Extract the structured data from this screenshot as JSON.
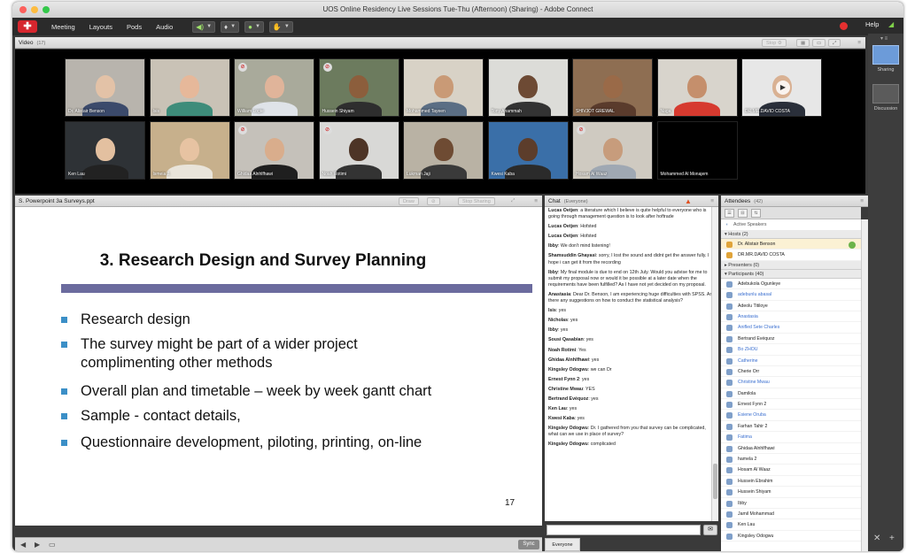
{
  "window": {
    "title": "UOS Online Residency Live Sessions Tue-Thu (Afternoon) (Sharing) - Adobe Connect"
  },
  "menubar": {
    "items": [
      "Meeting",
      "Layouts",
      "Pods",
      "Audio"
    ],
    "help": "Help"
  },
  "video_pod": {
    "title": "Video",
    "count": "(17)",
    "stop_label": "Stop",
    "participants": [
      {
        "name": "Dr. Alistair Benson",
        "bg": "#b8b4ad",
        "skin": "#e3c2a7",
        "shirt": "#3b4a6b",
        "muted": false
      },
      {
        "name": "Isis",
        "bg": "#c9c2b6",
        "skin": "#e6b89a",
        "shirt": "#3e8c7a",
        "muted": false
      },
      {
        "name": "William Logie",
        "bg": "#a9aa9b",
        "skin": "#e0b49a",
        "shirt": "#dfe3e8",
        "muted": true
      },
      {
        "name": "Hussein Shiyam",
        "bg": "#6c7b5e",
        "skin": "#8c5e3c",
        "shirt": "#2e2e2e",
        "muted": true
      },
      {
        "name": "Mohammed Tayeen",
        "bg": "#d8d2c6",
        "skin": "#c99a76",
        "shirt": "#5b6e84",
        "muted": false
      },
      {
        "name": "Tony Anammah",
        "bg": "#dcdcd8",
        "skin": "#6d4a34",
        "shirt": "#333",
        "muted": false
      },
      {
        "name": "SHIVJOT GREWAL",
        "bg": "#8e6e52",
        "skin": "#9a6a48",
        "shirt": "#5a3b2c",
        "muted": false
      },
      {
        "name": "Naga",
        "bg": "#d8d4cc",
        "skin": "#c58f6c",
        "shirt": "#d63a2f",
        "muted": false
      },
      {
        "name": "DR.MR.DAVID COSTA",
        "bg": "#e7e7e7",
        "skin": "#d9b193",
        "shirt": "#2a2f3a",
        "muted": false
      },
      {
        "name": "Ken Lau",
        "bg": "#2e3236",
        "skin": "#e3c0a0",
        "shirt": "#222",
        "muted": false
      },
      {
        "name": "Ismeia J.",
        "bg": "#c7b08c",
        "skin": "#e7c3a2",
        "shirt": "#e9e4da",
        "muted": false
      },
      {
        "name": "Ghidaa Alnhlfhawi",
        "bg": "#c5c1ba",
        "skin": "#d9ad8c",
        "shirt": "#1f1f1f",
        "muted": true
      },
      {
        "name": "Noah Rotimi",
        "bg": "#d8d8d6",
        "skin": "#4d3426",
        "shirt": "#333",
        "muted": true
      },
      {
        "name": "Lukman Jaji",
        "bg": "#b9b2a4",
        "skin": "#6e4b33",
        "shirt": "#3a3a3a",
        "muted": false
      },
      {
        "name": "Kwesi Kaba",
        "bg": "#3a6fa8",
        "skin": "#5c3d2b",
        "shirt": "#2b2b2b",
        "muted": false
      },
      {
        "name": "Hosam Al Waaz",
        "bg": "#cfcac1",
        "skin": "#c79c7c",
        "shirt": "#9fa8b3",
        "muted": true
      },
      {
        "name": "Mohammed Al Monajem",
        "bg": "#000000",
        "skin": "#000000",
        "shirt": "#000000",
        "muted": false
      }
    ]
  },
  "layouts": [
    {
      "label": "Sharing",
      "active": true
    },
    {
      "label": "Discussion",
      "active": false
    }
  ],
  "share_pod": {
    "title": "S. Powerpoint 3a Surveys.ppt",
    "draw_label": "Draw",
    "stop_sharing_label": "Stop Sharing",
    "sync_label": "Sync",
    "slide": {
      "title": "3. Research Design and Survey Planning",
      "bullets": [
        "Research design",
        "The survey might be part of a wider project complimenting other methods",
        "Overall plan and timetable – week by week gantt chart",
        "Sample - contact details,",
        "Questionnaire development, piloting, printing, on-line"
      ],
      "page": "17"
    }
  },
  "chat_pod": {
    "title": "Chat",
    "scope": "(Everyone)",
    "tab": "Everyone",
    "messages": [
      {
        "from": "Lucas Oetjen",
        "text": "a literature which I believe is quite helpful to everyone who is going through management question is to look after hoftrade"
      },
      {
        "from": "Lucas Oetjen",
        "text": "Hofsted"
      },
      {
        "from": "Lucas Oetjen",
        "text": "Hofsted"
      },
      {
        "from": "Ibby",
        "text": "We don't mind listening!"
      },
      {
        "from": "Shamsuddin Ghayasi",
        "text": "sorry, I lost the sound and didnt get the answer fully. I hope i can get it from the recording"
      },
      {
        "from": "Ibby",
        "text": "My final module is due to end on 12th July. Would you advise for me to submit my proposal now or would it be possible at a later date when the requirements have been fulfilled? As I have not yet decided on my proposal."
      },
      {
        "from": "Anastasia",
        "text": "Dear Dr. Benson, I am experiencing huge difficulties with SPSS. Are there any suggestions on how to conduct the statistical analysis?"
      },
      {
        "from": "Isis",
        "text": "yes"
      },
      {
        "from": "Nicholas",
        "text": "yes"
      },
      {
        "from": "Ibby",
        "text": "yes"
      },
      {
        "from": "Sousi Qasabian",
        "text": "yes"
      },
      {
        "from": "Noah Rotimi",
        "text": "Yes"
      },
      {
        "from": "Ghidaa Alnhlfhawi",
        "text": "yes"
      },
      {
        "from": "Kingsley Odogwu",
        "text": "we can Dr"
      },
      {
        "from": "Ernest Fynn 2",
        "text": "yes"
      },
      {
        "from": "Christine Mwau",
        "text": "YES"
      },
      {
        "from": "Bertrand Evéquoz",
        "text": "yes"
      },
      {
        "from": "Ken Lau",
        "text": "yes"
      },
      {
        "from": "Kwesi Kaba",
        "text": "yes"
      },
      {
        "from": "Kingsley Odogwu",
        "text": "Dr. I gathered from you that survey can be complicated, what can we use in place of survey?"
      },
      {
        "from": "Kingsley Odogwu",
        "text": "complicated"
      }
    ]
  },
  "attendees_pod": {
    "title": "Attendees",
    "count": "(42)",
    "active_speakers": "Active Speakers",
    "hosts_label": "Hosts (2)",
    "presenters_label": "Presenters (0)",
    "participants_label": "Participants (40)",
    "hosts": [
      {
        "name": "Dr. Alistair Benson",
        "style": "normal"
      },
      {
        "name": "DR.MR.DAVID COSTA",
        "style": "normal"
      }
    ],
    "participants": [
      {
        "name": "Adebukola Ogunleye",
        "style": "normal"
      },
      {
        "name": "adebunlu abasal",
        "style": "blue"
      },
      {
        "name": "Adeolu Titiloye",
        "style": "normal"
      },
      {
        "name": "Anastasia",
        "style": "blue"
      },
      {
        "name": "Anifled Sete Charles",
        "style": "blue"
      },
      {
        "name": "Bertrand Evéquoz",
        "style": "normal"
      },
      {
        "name": "Bo ZHOU",
        "style": "blue"
      },
      {
        "name": "Catherine",
        "style": "blue"
      },
      {
        "name": "Cherie Orr",
        "style": "normal"
      },
      {
        "name": "Christine Mwau",
        "style": "blue"
      },
      {
        "name": "Damilola",
        "style": "normal"
      },
      {
        "name": "Ernest Fynn 2",
        "style": "normal"
      },
      {
        "name": "Esiene Oruba",
        "style": "blue"
      },
      {
        "name": "Farhan Tahir 2",
        "style": "normal"
      },
      {
        "name": "Fatima",
        "style": "blue"
      },
      {
        "name": "Ghidaa Alnhlfhawi",
        "style": "normal"
      },
      {
        "name": "hamela 2",
        "style": "normal"
      },
      {
        "name": "Hosam Al Waaz",
        "style": "normal"
      },
      {
        "name": "Hussein Ebrahim",
        "style": "normal"
      },
      {
        "name": "Hussein Shiyam",
        "style": "normal"
      },
      {
        "name": "Ibby",
        "style": "normal"
      },
      {
        "name": "Jamil Mohammad",
        "style": "normal"
      },
      {
        "name": "Ken Lau",
        "style": "normal"
      },
      {
        "name": "Kingsley Odogwu",
        "style": "normal"
      }
    ]
  },
  "colors": {
    "accent": "#3b8fc7",
    "record": "#e53030",
    "slide_bar": "#6b6b9e",
    "host_highlight": "#fbf1d4"
  }
}
